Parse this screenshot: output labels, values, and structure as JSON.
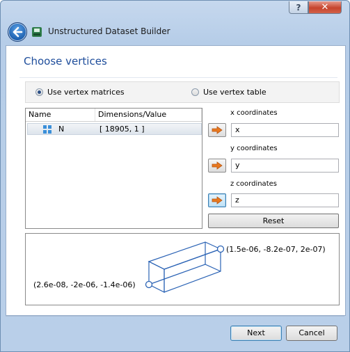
{
  "titlebar": {
    "help_label": "?",
    "close_label": "✕"
  },
  "header": {
    "app_title": "Unstructured Dataset Builder"
  },
  "page": {
    "title": "Choose vertices"
  },
  "options": {
    "vertex_matrices_label": "Use vertex matrices",
    "vertex_table_label": "Use vertex table",
    "selected": "vertex_matrices"
  },
  "variables_table": {
    "columns": [
      "Name",
      "Dimensions/Value"
    ],
    "rows": [
      {
        "name": "N",
        "dimensions": "[ 18905, 1 ]"
      }
    ]
  },
  "coordinates": {
    "x": {
      "label": "x coordinates",
      "value": "x"
    },
    "y": {
      "label": "y coordinates",
      "value": "y"
    },
    "z": {
      "label": "z coordinates",
      "value": "z"
    }
  },
  "reset_label": "Reset",
  "preview": {
    "max_corner_label": "(1.5e-06, -8.2e-07, 2e-07)",
    "min_corner_label": "(2.6e-08, -2e-06, -1.4e-06)"
  },
  "footer": {
    "next_label": "Next",
    "cancel_label": "Cancel"
  },
  "colors": {
    "accent": "#1e4d9b",
    "box_stroke": "#2b63b5",
    "arrow": "#e8781f"
  }
}
